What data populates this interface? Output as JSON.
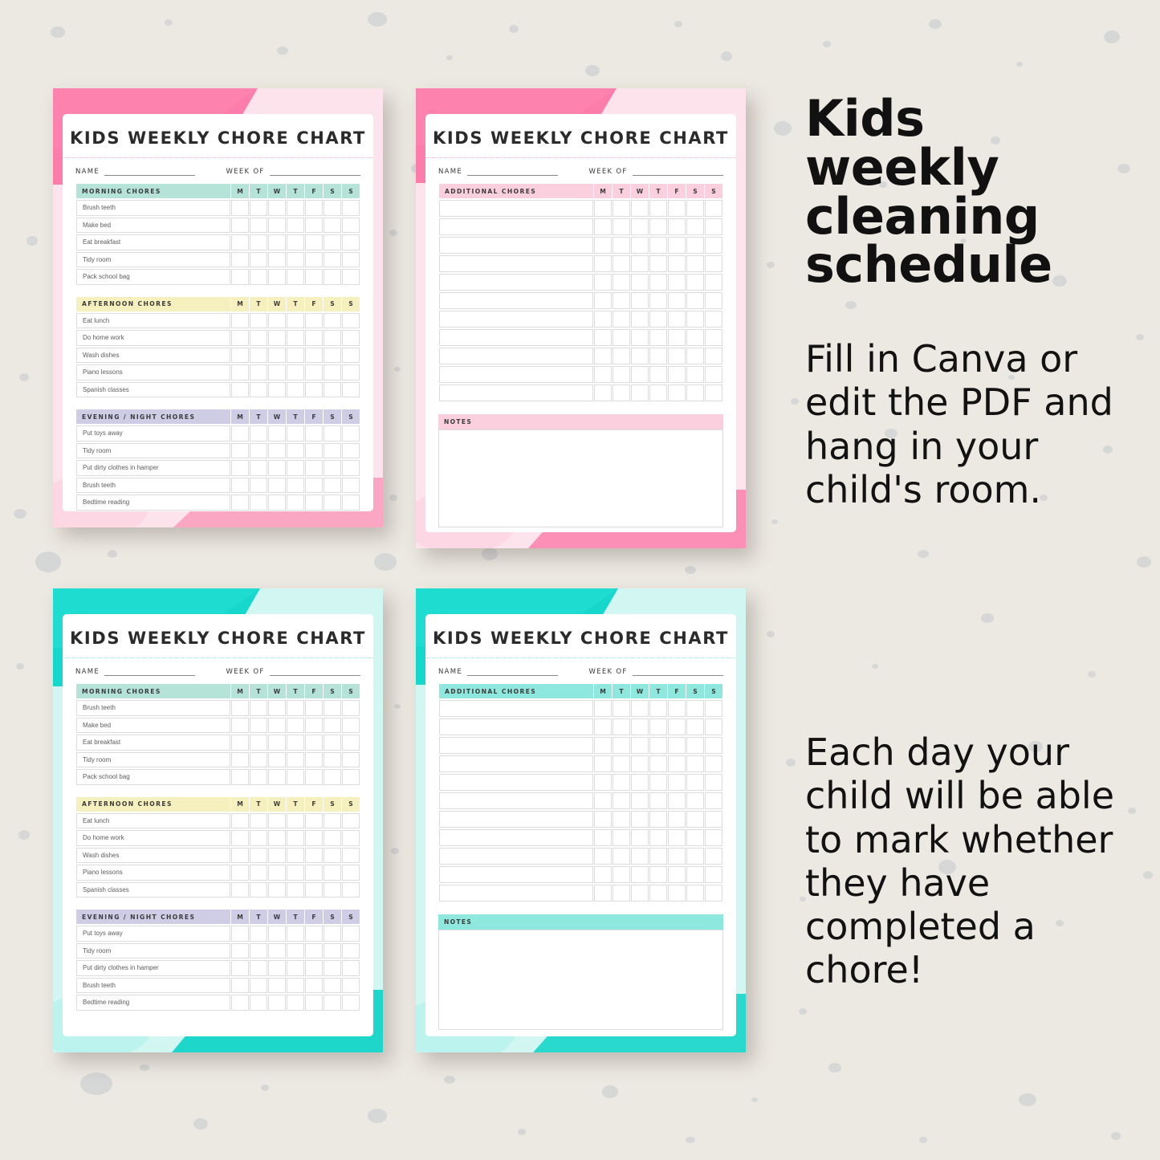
{
  "background": {
    "color": "#ece9e2",
    "speckle_color": "#c9ccd1"
  },
  "promo": {
    "headline": "Kids weekly cleaning schedule",
    "headline_lines": [
      "Kids weekly",
      "cleaning",
      "schedule"
    ],
    "paragraph_1": "Fill in Canva or edit the PDF and hang in your child's room.",
    "paragraph_2": "Each day your child will be able to mark whether they have completed a chore!"
  },
  "sheet": {
    "title": "KIDS WEEKLY CHORE CHART",
    "name_label": "NAME",
    "week_label": "WEEK OF",
    "notes_label": "NOTES",
    "days": [
      "M",
      "T",
      "W",
      "T",
      "F",
      "S",
      "S"
    ]
  },
  "sections": {
    "morning": {
      "label": "MORNING CHORES",
      "color_pink_card": "#b5e3d8",
      "color_teal_card": "#b5e3d8",
      "tasks": [
        "Brush teeth",
        "Make bed",
        "Eat breakfast",
        "Tidy room",
        "Pack school bag"
      ]
    },
    "afternoon": {
      "label": "AFTERNOON CHORES",
      "color": "#f6efbe",
      "tasks": [
        "Eat lunch",
        "Do home work",
        "Wash dishes",
        "Piano lessons",
        "Spanish classes"
      ]
    },
    "evening": {
      "label": "EVENING / NIGHT  CHORES",
      "color": "#cfcde6",
      "tasks": [
        "Put toys away",
        "Tidy room",
        "Put dirty clothes in hamper",
        "Brush teeth",
        "Bedtime reading"
      ]
    },
    "additional": {
      "label": "ADDITIONAL CHORES",
      "color_pink_card": "#fbcfdd",
      "color_teal_card": "#8fe8dd",
      "empty_row_count": 11
    }
  },
  "cards": [
    {
      "id": "pink-chores",
      "variant": "pink",
      "accent_dark": "#fd7daa",
      "accent_light": "#fde3ec",
      "type": "daily"
    },
    {
      "id": "pink-additional",
      "variant": "pink",
      "accent_dark": "#fd7daa",
      "accent_light": "#fde3ec",
      "type": "additional"
    },
    {
      "id": "teal-chores",
      "variant": "teal",
      "accent_dark": "#15d7cb",
      "accent_light": "#d2f7f3",
      "type": "daily"
    },
    {
      "id": "teal-additional",
      "variant": "teal",
      "accent_dark": "#15d7cb",
      "accent_light": "#d2f7f3",
      "type": "additional"
    }
  ]
}
